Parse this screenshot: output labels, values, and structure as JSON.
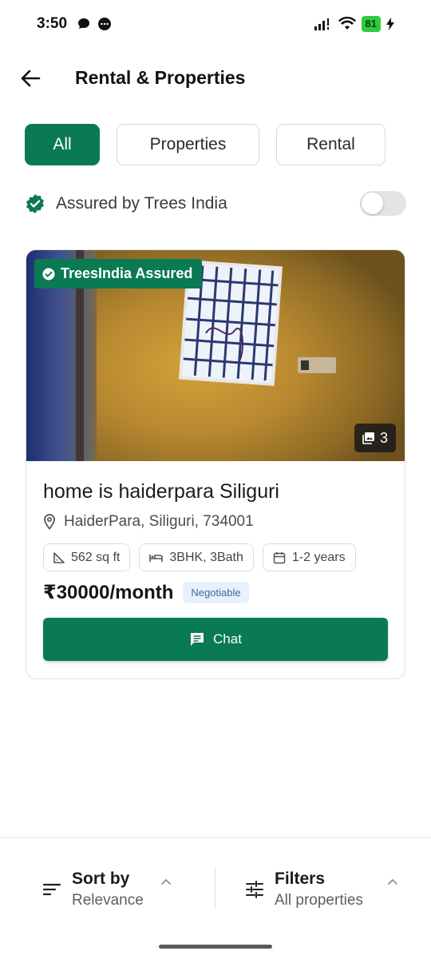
{
  "status_bar": {
    "time": "3:50",
    "battery": "81"
  },
  "header": {
    "title": "Rental & Properties",
    "back_icon": "arrow-left-icon"
  },
  "tabs": [
    {
      "label": "All",
      "active": true
    },
    {
      "label": "Properties",
      "active": false
    },
    {
      "label": "Rental",
      "active": false
    }
  ],
  "assured_filter": {
    "label": "Assured by Trees India",
    "enabled": false
  },
  "listing": {
    "badge": "TreesIndia Assured",
    "photo_count": "3",
    "title": "home is haiderpara Siliguri",
    "location": "HaiderPara, Siliguri, 734001",
    "area": "562 sq ft",
    "configuration": "3BHK, 3Bath",
    "duration": "1-2 years",
    "price": "₹30000/month",
    "negotiable": "Negotiable",
    "chat_label": "Chat"
  },
  "bottom_bar": {
    "sort_label": "Sort by",
    "sort_value": "Relevance",
    "filter_label": "Filters",
    "filter_value": "All properties"
  },
  "colors": {
    "brand_green": "#0a7a52",
    "negotiable_bg": "#e8f1fb",
    "negotiable_text": "#3a6b9c"
  }
}
